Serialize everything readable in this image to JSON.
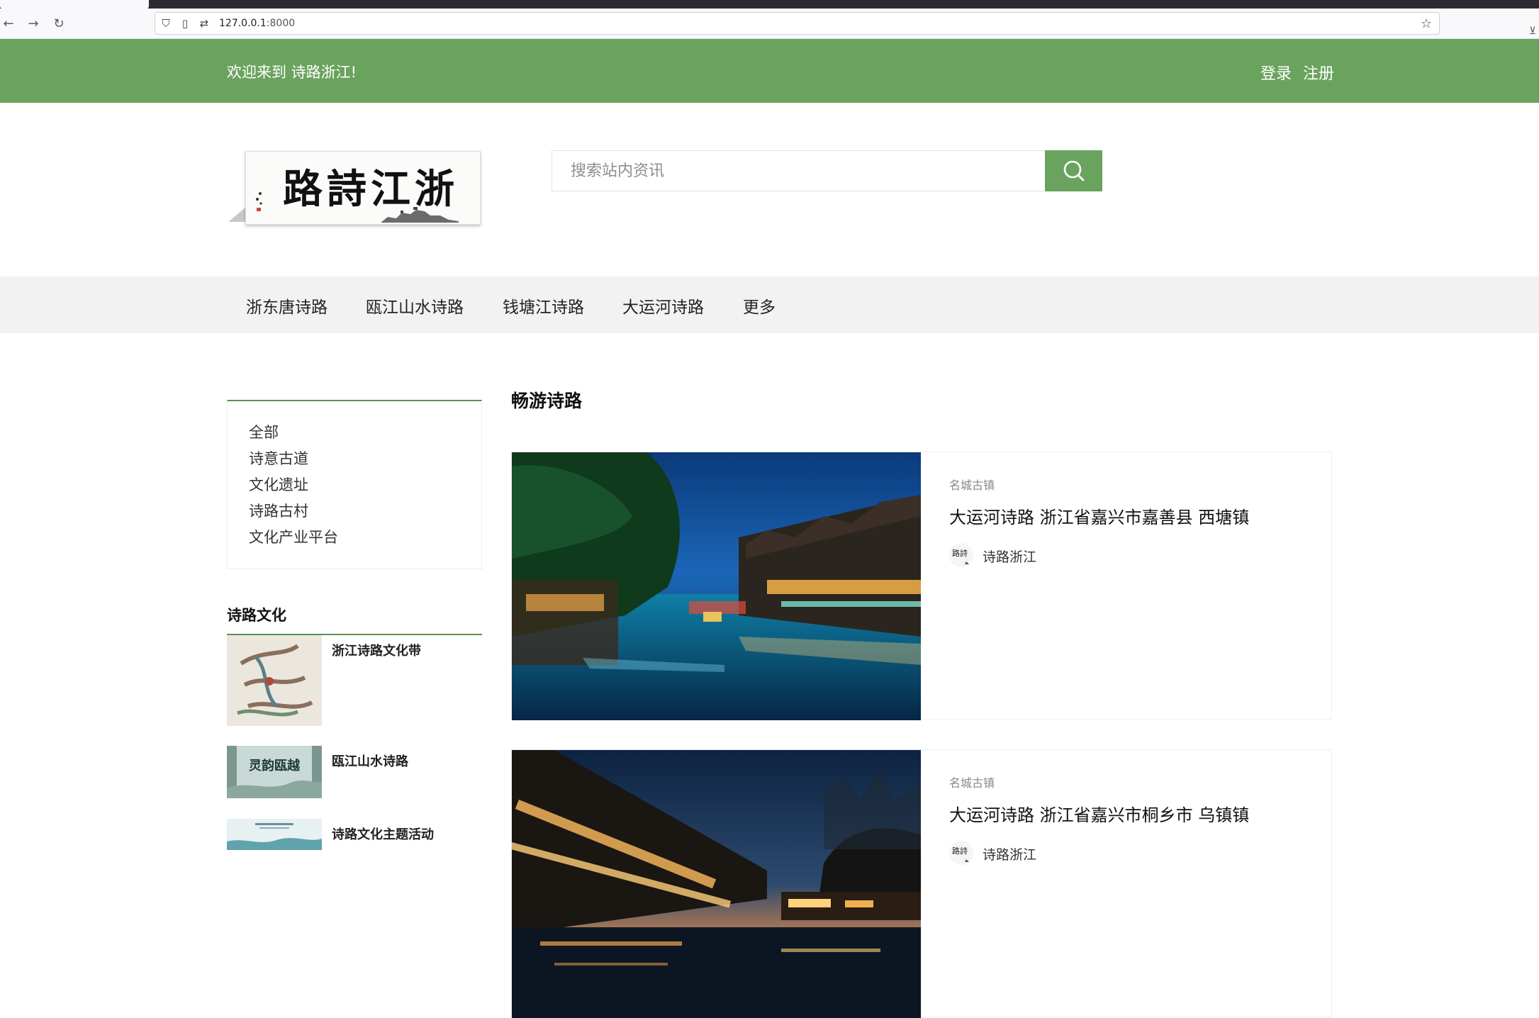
{
  "browser": {
    "url_host": "127.0.0.1",
    "url_port": ":8000"
  },
  "topbar": {
    "welcome": "欢迎来到 诗路浙江!",
    "login": "登录",
    "register": "注册",
    "color": "#6aa35e"
  },
  "logo": {
    "calligraphy": "路詩江浙"
  },
  "search": {
    "placeholder": "搜索站内资讯"
  },
  "menu": {
    "items": [
      "浙东唐诗路",
      "瓯江山水诗路",
      "钱塘江诗路",
      "大运河诗路",
      "更多"
    ]
  },
  "sidebar": {
    "categories": [
      "全部",
      "诗意古道",
      "文化遗址",
      "诗路古村",
      "文化产业平台"
    ],
    "culture_title": "诗路文化",
    "articles": [
      "浙江诗路文化带",
      "瓯江山水诗路",
      "诗路文化主题活动"
    ],
    "thumb2_text": "灵韵瓯越"
  },
  "main": {
    "title": "畅游诗路",
    "cards": [
      {
        "tag": "名城古镇",
        "title": "大运河诗路 浙江省嘉兴市嘉善县 西塘镇",
        "author": "诗路浙江"
      },
      {
        "tag": "名城古镇",
        "title": "大运河诗路 浙江省嘉兴市桐乡市 乌镇镇",
        "author": "诗路浙江"
      }
    ]
  }
}
